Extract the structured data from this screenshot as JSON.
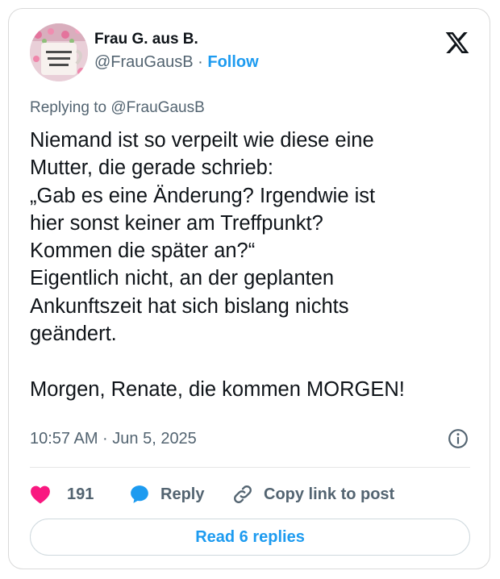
{
  "author": {
    "display_name": "Frau G. aus B.",
    "handle": "@FrauGausB",
    "separator": "·",
    "follow_label": "Follow"
  },
  "replying_to": "Replying to @FrauGausB",
  "tweet": {
    "text": "Niemand ist so verpeilt wie diese eine\nMutter, die gerade schrieb:\n„Gab es eine Änderung? Irgendwie ist\nhier sonst keiner am Treffpunkt?\nKommen die später an?“\nEigentlich nicht, an der geplanten\nAnkunftszeit hat sich bislang nichts\ngeändert.\n\nMorgen, Renate, die kommen MORGEN!",
    "timestamp": "10:57 AM · Jun 5, 2025"
  },
  "actions": {
    "like_count": "191",
    "reply_label": "Reply",
    "copy_link_label": "Copy link to post"
  },
  "read_replies_label": "Read 6 replies",
  "colors": {
    "accent": "#1d9bf0",
    "like": "#f91880",
    "text": "#0f1419",
    "muted": "#536471"
  },
  "icons": {
    "avatar": "mug-avatar",
    "brand": "x-logo-icon",
    "info": "info-icon",
    "like": "heart-icon",
    "reply": "speech-bubble-icon",
    "copy": "link-icon"
  }
}
